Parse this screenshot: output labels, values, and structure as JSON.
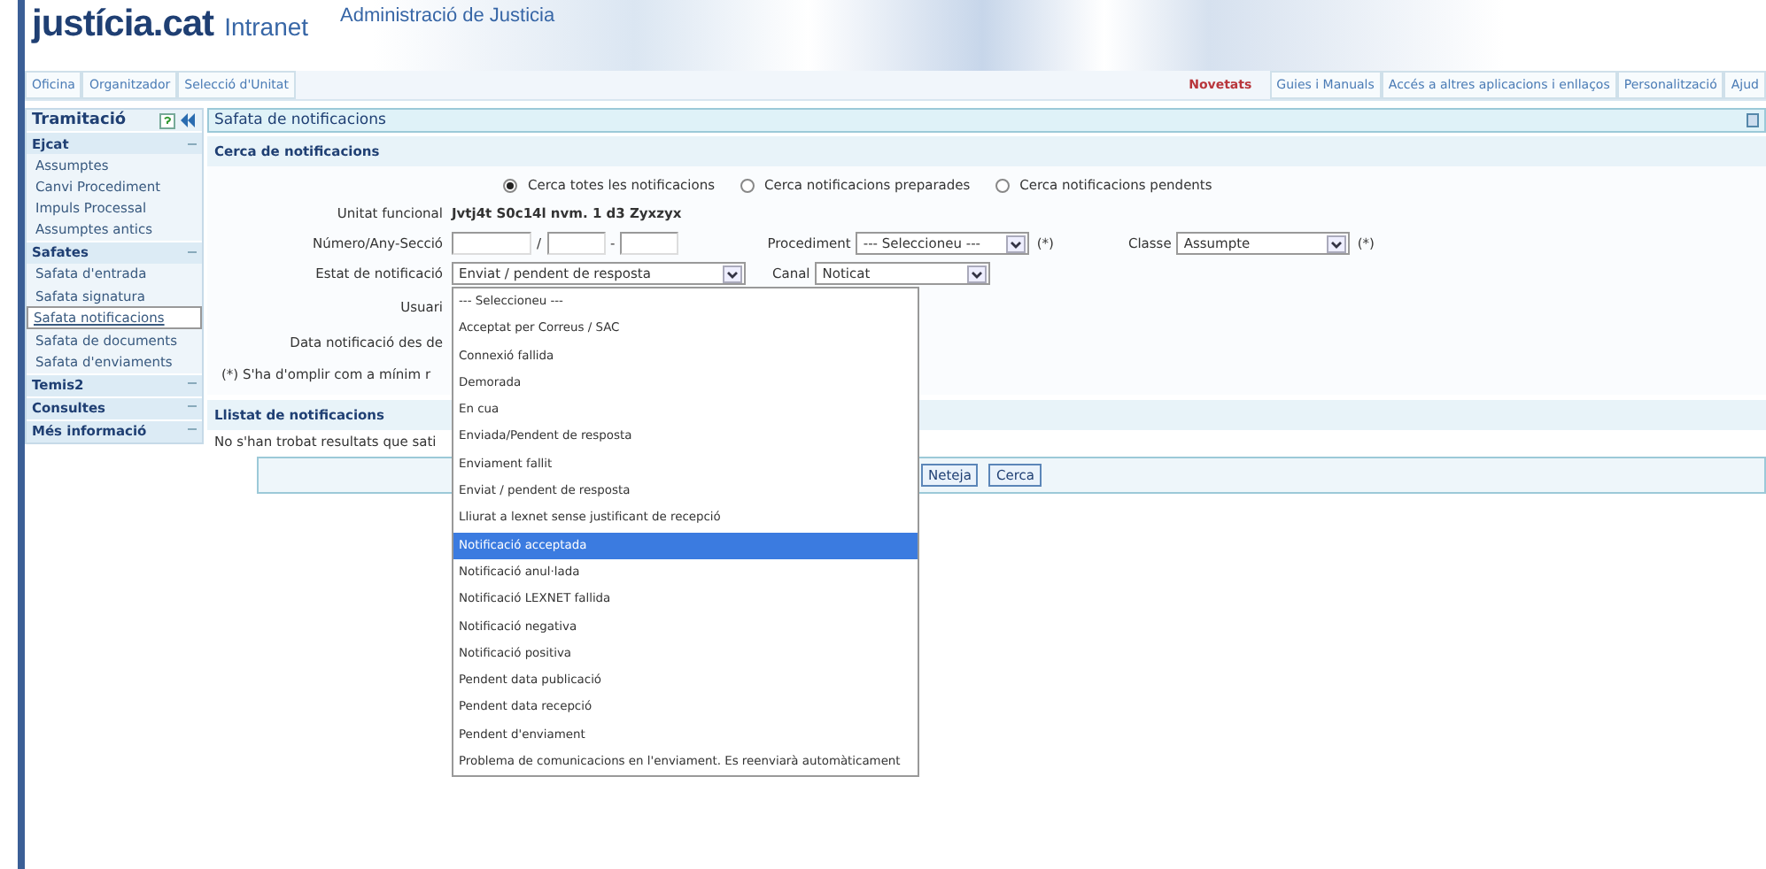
{
  "header": {
    "brand": "justícia.cat",
    "product": "Intranet",
    "subtitle": "Administració de Justicia"
  },
  "nav_left": [
    "Oficina",
    "Organitzador",
    "Selecció d'Unitat"
  ],
  "nav_right": [
    {
      "label": "Novetats",
      "kind": "highlight"
    },
    {
      "label": "Guies i Manuals",
      "kind": "tab"
    },
    {
      "label": "Accés a altres aplicacions i enllaços",
      "kind": "tab"
    },
    {
      "label": "Personalització",
      "kind": "tab"
    },
    {
      "label": "Ajud",
      "kind": "tab"
    }
  ],
  "sidebar": {
    "title": "Tramitació",
    "sections": [
      {
        "title": "Ejcat",
        "expanded": true,
        "items": [
          {
            "label": "Assumptes",
            "selected": false
          },
          {
            "label": "Canvi Procediment",
            "selected": false
          },
          {
            "label": "Impuls Processal",
            "selected": false
          },
          {
            "label": "Assumptes antics",
            "selected": false
          }
        ]
      },
      {
        "title": "Safates",
        "expanded": true,
        "items": [
          {
            "label": "Safata d'entrada",
            "selected": false
          },
          {
            "label": "Safata signatura",
            "selected": false
          },
          {
            "label": "Safata notificacions",
            "selected": true
          },
          {
            "label": "Safata de documents",
            "selected": false
          },
          {
            "label": "Safata d'enviaments",
            "selected": false
          }
        ]
      },
      {
        "title": "Temis2",
        "expanded": false
      },
      {
        "title": "Consultes",
        "expanded": false
      },
      {
        "title": "Més informació",
        "expanded": false
      }
    ]
  },
  "panel_title": "Safata de notificacions",
  "search": {
    "title": "Cerca de notificacions",
    "radios": [
      {
        "label": "Cerca totes les notificacions",
        "selected": true
      },
      {
        "label": "Cerca notificacions preparades",
        "selected": false
      },
      {
        "label": "Cerca notificacions pendents",
        "selected": false
      }
    ],
    "unit_label": "Unitat funcional",
    "unit_value": "Jvtj4t S0c14l nvm. 1 d3 Zyxzyx",
    "number_label": "Número/Any-Secció",
    "number_sep1": "/",
    "number_sep2": "-",
    "procediment_label": "Procediment",
    "procediment_value": "--- Seleccioneu ---",
    "procediment_note": "(*)",
    "classe_label": "Classe",
    "classe_value": "Assumpte",
    "classe_note": "(*)",
    "estat_label": "Estat de notificació",
    "estat_value": "Enviat / pendent de resposta",
    "canal_label": "Canal",
    "canal_value": "Noticat",
    "usuari_label": "Usuari",
    "data_label": "Data notificació des de",
    "note": "(*) S'ha d'omplir com a mínim r"
  },
  "list": {
    "title": "Llistat de notificacions",
    "message": "No s'han trobat resultats que sati"
  },
  "buttons": [
    "Neteja",
    "Cerca"
  ],
  "dropdown": [
    {
      "label": "--- Seleccioneu ---",
      "selected": false
    },
    {
      "label": "Acceptat per Correus / SAC",
      "selected": false
    },
    {
      "label": "Connexió fallida",
      "selected": false
    },
    {
      "label": "Demorada",
      "selected": false
    },
    {
      "label": "En cua",
      "selected": false
    },
    {
      "label": "Enviada/Pendent de resposta",
      "selected": false
    },
    {
      "label": "Enviament fallit",
      "selected": false
    },
    {
      "label": "Enviat / pendent de resposta",
      "selected": false
    },
    {
      "label": "Lliurat a lexnet sense justificant de recepció",
      "selected": false
    },
    {
      "label": "Notificació acceptada",
      "selected": true
    },
    {
      "label": "Notificació anul·lada",
      "selected": false
    },
    {
      "label": "Notificació LEXNET fallida",
      "selected": false
    },
    {
      "label": "Notificació negativa",
      "selected": false
    },
    {
      "label": "Notificació positiva",
      "selected": false
    },
    {
      "label": "Pendent data publicació",
      "selected": false
    },
    {
      "label": "Pendent data recepció",
      "selected": false
    },
    {
      "label": "Pendent d'enviament",
      "selected": false
    },
    {
      "label": "Problema de comunicacions en l'enviament. Es reenviarà automàticament",
      "selected": false
    }
  ]
}
